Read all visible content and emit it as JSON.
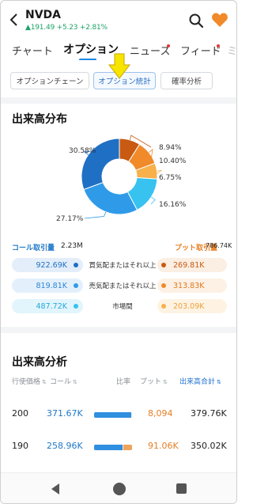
{
  "header": {
    "ticker": "NVDA",
    "quote": "▲191.49 +5.23 +2.81%"
  },
  "tabs": [
    {
      "label": "チャート"
    },
    {
      "label": "オプション"
    },
    {
      "label": "ニュース"
    },
    {
      "label": "フィード"
    },
    {
      "label": "ミ"
    }
  ],
  "subtabs": [
    {
      "label": "オプションチェーン"
    },
    {
      "label": "オプション統計"
    },
    {
      "label": "確率分析"
    }
  ],
  "distribution": {
    "title": "出来高分布",
    "call_label": "コール取引量",
    "call_total": "2.23M",
    "put_label": "プット取引量",
    "put_total": "786.74K",
    "rows": [
      {
        "call": "922.69K",
        "label": "買気配またはそれ以上",
        "put": "269.81K"
      },
      {
        "call": "819.81K",
        "label": "売気配またはそれ以上",
        "put": "313.83K"
      },
      {
        "call": "487.72K",
        "label": "市場間",
        "put": "203.09K"
      }
    ]
  },
  "chart_data": {
    "type": "pie",
    "categories": [
      "コール 買気配またはそれ以上",
      "コール 売気配またはそれ以上",
      "コール 市場間",
      "プット 買気配またはそれ以上",
      "プット 売気配またはそれ以上",
      "プット 市場間"
    ],
    "values": [
      30.58,
      27.17,
      16.16,
      8.94,
      10.4,
      6.75
    ],
    "labels": [
      "30.58%",
      "27.17%",
      "16.16%",
      "8.94%",
      "10.40%",
      "6.75%"
    ]
  },
  "analysis": {
    "title": "出来高分析",
    "headers": [
      "行使価格",
      "コール",
      "比率",
      "プット",
      "出来高合計"
    ],
    "rows": [
      {
        "strike": "200",
        "call": "371.67K",
        "put": "8,094",
        "total": "379.76K",
        "call_ratio": 0.979
      },
      {
        "strike": "190",
        "call": "258.96K",
        "put": "91.06K",
        "total": "350.02K",
        "call_ratio": 0.74
      }
    ]
  },
  "colors": {
    "call_dark": "#1f6fc4",
    "call_mid": "#2f9be8",
    "call_light": "#37c2f0",
    "put_dark": "#c85a12",
    "put_mid": "#f08a2a",
    "put_light": "#f7b04a",
    "accent": "#1e88e5",
    "up_green": "#1fa36a"
  }
}
